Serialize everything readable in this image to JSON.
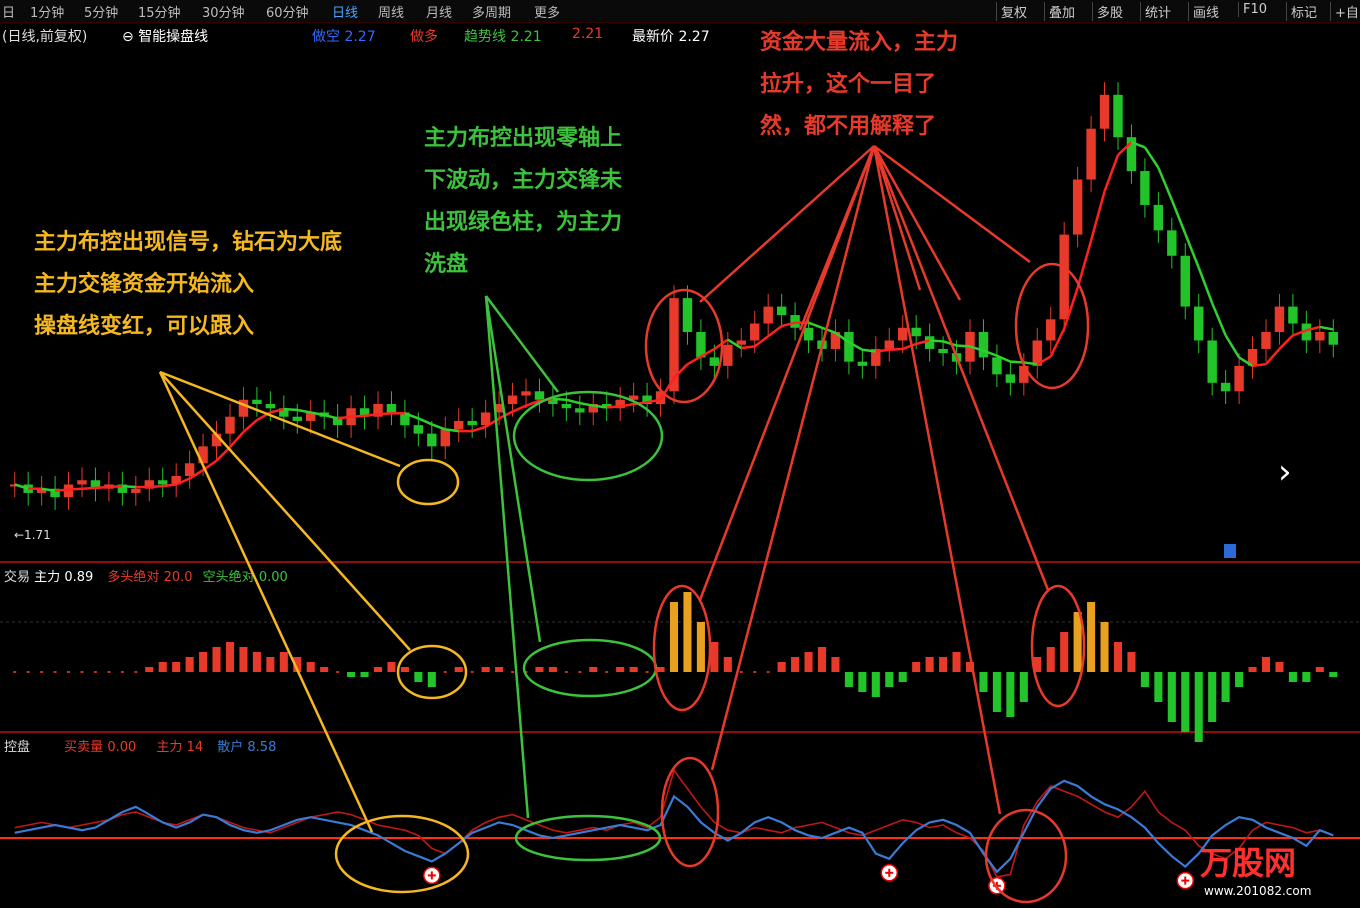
{
  "topbar": {
    "tabs": [
      "日",
      "1分钟",
      "5分钟",
      "15分钟",
      "30分钟",
      "60分钟",
      "日线",
      "周线",
      "月线",
      "多周期",
      "更多"
    ],
    "active_index": 6,
    "right_buttons": [
      "复权",
      "叠加",
      "多股",
      "统计",
      "画线",
      "F10",
      "标记",
      "+自"
    ]
  },
  "main_header": {
    "title": "(日线,前复权)",
    "indicator_name": "智能操盘线",
    "items": [
      {
        "label": "做空",
        "value": "2.27",
        "color": "#2f6bff"
      },
      {
        "label": "做多",
        "value": "",
        "color": "#e83a2a"
      },
      {
        "label": "趋势线",
        "value": "2.21",
        "color": "#3cc23c"
      },
      {
        "label": "",
        "value": "2.21",
        "color": "#e83a2a"
      },
      {
        "label": "最新价",
        "value": "2.27",
        "color": "#ffffff"
      }
    ],
    "low_price_label": "←1.71"
  },
  "panel2_header": {
    "name": "交易",
    "items": [
      {
        "label": "主力",
        "value": "0.89",
        "color": "#ffffff"
      },
      {
        "label": "多头绝对",
        "value": "20.0",
        "color": "#e83a2a"
      },
      {
        "label": "空头绝对",
        "value": "0.00",
        "color": "#3cc23c"
      }
    ]
  },
  "panel3_header": {
    "name": "控盘",
    "items": [
      {
        "label": "买卖量",
        "value": "0.00",
        "color": "#e83a2a"
      },
      {
        "label": "主力",
        "value": "14",
        "color": "#e83a2a"
      },
      {
        "label": "散户",
        "value": "8.58",
        "color": "#2f6bff"
      }
    ]
  },
  "annotations": {
    "yellow": [
      "主力布控出现信号，钻石为大底",
      "主力交锋资金开始流入",
      "操盘线变红，可以跟入"
    ],
    "green": [
      "主力布控出现零轴上",
      "下波动，主力交锋未",
      "出现绿色柱，为主力",
      "洗盘"
    ],
    "red": [
      "资金大量流入，主力",
      "拉升，这个一目了",
      "然，都不用解释了"
    ]
  },
  "watermark": {
    "brand": "万股网",
    "url": "www.201082.com"
  },
  "colors": {
    "up": "#e83a2a",
    "down": "#22c42a",
    "bullish_line": "#ff2020",
    "bearish_line": "#2ed12e",
    "retail_line": "#3a7bd5",
    "separator": "#c01010",
    "yellow_ann": "#f5b820",
    "green_ann": "#3cc23c",
    "red_ann": "#e83a2a"
  },
  "chart_data": [
    {
      "type": "candlestick",
      "panel": "main",
      "y_range": [
        1.71,
        2.9
      ],
      "closes": [
        1.86,
        1.84,
        1.85,
        1.83,
        1.86,
        1.87,
        1.85,
        1.86,
        1.84,
        1.85,
        1.87,
        1.86,
        1.88,
        1.91,
        1.95,
        1.98,
        2.02,
        2.06,
        2.05,
        2.04,
        2.02,
        2.01,
        2.03,
        2.02,
        2.0,
        2.04,
        2.02,
        2.05,
        2.03,
        2.0,
        1.98,
        1.95,
        1.99,
        2.01,
        2.0,
        2.03,
        2.05,
        2.07,
        2.08,
        2.06,
        2.05,
        2.04,
        2.03,
        2.05,
        2.04,
        2.06,
        2.07,
        2.05,
        2.08,
        2.3,
        2.22,
        2.16,
        2.14,
        2.19,
        2.2,
        2.24,
        2.28,
        2.26,
        2.23,
        2.2,
        2.18,
        2.22,
        2.15,
        2.14,
        2.18,
        2.2,
        2.23,
        2.21,
        2.18,
        2.17,
        2.15,
        2.22,
        2.16,
        2.12,
        2.1,
        2.14,
        2.2,
        2.25,
        2.45,
        2.58,
        2.7,
        2.78,
        2.68,
        2.6,
        2.52,
        2.46,
        2.4,
        2.28,
        2.2,
        2.1,
        2.08,
        2.14,
        2.18,
        2.22,
        2.28,
        2.24,
        2.2,
        2.22,
        2.19
      ],
      "last_price": 2.27
    },
    {
      "type": "bar",
      "panel": "主力交易",
      "values": [
        0,
        0,
        0,
        0,
        0,
        0,
        0,
        0,
        0,
        0,
        1,
        2,
        2,
        3,
        4,
        5,
        6,
        5,
        4,
        3,
        4,
        3,
        2,
        1,
        0,
        -1,
        -1,
        1,
        2,
        1,
        -2,
        -3,
        0,
        1,
        0,
        1,
        1,
        0,
        0,
        1,
        1,
        0,
        0,
        1,
        0,
        1,
        1,
        0,
        1,
        14,
        16,
        10,
        6,
        3,
        0,
        0,
        0,
        2,
        3,
        4,
        5,
        3,
        -3,
        -4,
        -5,
        -3,
        -2,
        2,
        3,
        3,
        4,
        2,
        -4,
        -8,
        -9,
        -6,
        3,
        5,
        8,
        12,
        14,
        10,
        6,
        4,
        -3,
        -6,
        -10,
        -12,
        -14,
        -10,
        -6,
        -3,
        1,
        3,
        2,
        -2,
        -2,
        1,
        -1
      ],
      "baseline": 0
    },
    {
      "type": "line",
      "panel": "控盘",
      "series": [
        {
          "name": "主力",
          "values": [
            0.4,
            0.5,
            0.6,
            0.5,
            0.4,
            0.5,
            0.6,
            0.7,
            0.9,
            1.0,
            0.8,
            0.6,
            0.5,
            0.7,
            0.9,
            0.8,
            0.6,
            0.4,
            0.3,
            0.2,
            0.4,
            0.6,
            0.8,
            0.9,
            1.0,
            0.9,
            0.7,
            0.5,
            0.4,
            0.3,
            0.1,
            -0.4,
            -0.6,
            -0.2,
            0.3,
            0.6,
            0.8,
            0.9,
            0.7,
            0.5,
            0.3,
            0.2,
            0.3,
            0.4,
            0.3,
            0.5,
            0.6,
            0.4,
            0.8,
            2.6,
            1.9,
            1.2,
            0.6,
            0.3,
            0.2,
            0.4,
            0.3,
            0.2,
            0.4,
            0.5,
            0.6,
            0.4,
            0.2,
            0.1,
            0.3,
            0.5,
            0.7,
            0.6,
            0.4,
            0.5,
            0.2,
            0.0,
            -0.5,
            -1.5,
            -1.4,
            0.5,
            1.4,
            2.0,
            1.8,
            1.6,
            1.3,
            1.0,
            0.8,
            1.2,
            1.8,
            1.0,
            0.6,
            0.3,
            -0.3,
            -0.6,
            -0.8,
            -0.4,
            0.3,
            0.6,
            0.5,
            0.4,
            0.2,
            0.3,
            0.1
          ]
        },
        {
          "name": "散户",
          "values": [
            0.2,
            0.3,
            0.4,
            0.5,
            0.4,
            0.3,
            0.4,
            0.7,
            1.0,
            1.2,
            0.9,
            0.6,
            0.4,
            0.6,
            0.9,
            0.8,
            0.5,
            0.3,
            0.2,
            0.3,
            0.5,
            0.7,
            0.8,
            0.7,
            0.6,
            0.5,
            0.3,
            0.1,
            -0.2,
            -0.5,
            -0.7,
            -0.9,
            -0.6,
            -0.2,
            0.2,
            0.4,
            0.6,
            0.5,
            0.3,
            0.1,
            0.0,
            0.1,
            0.2,
            0.3,
            0.4,
            0.5,
            0.4,
            0.3,
            0.5,
            1.6,
            1.2,
            0.6,
            0.2,
            -0.1,
            0.2,
            0.6,
            0.8,
            0.6,
            0.3,
            0.1,
            0.0,
            0.2,
            0.4,
            0.2,
            -0.6,
            -0.8,
            -0.2,
            0.3,
            0.6,
            0.7,
            0.5,
            0.2,
            -0.6,
            -1.3,
            -0.8,
            0.2,
            1.2,
            1.9,
            2.2,
            2.0,
            1.6,
            1.3,
            1.1,
            0.8,
            0.4,
            -0.2,
            -0.7,
            -1.1,
            -0.6,
            0.1,
            0.5,
            0.8,
            0.7,
            0.4,
            0.2,
            0.0,
            -0.3,
            0.3,
            0.1
          ]
        }
      ],
      "baseline": 0
    }
  ]
}
